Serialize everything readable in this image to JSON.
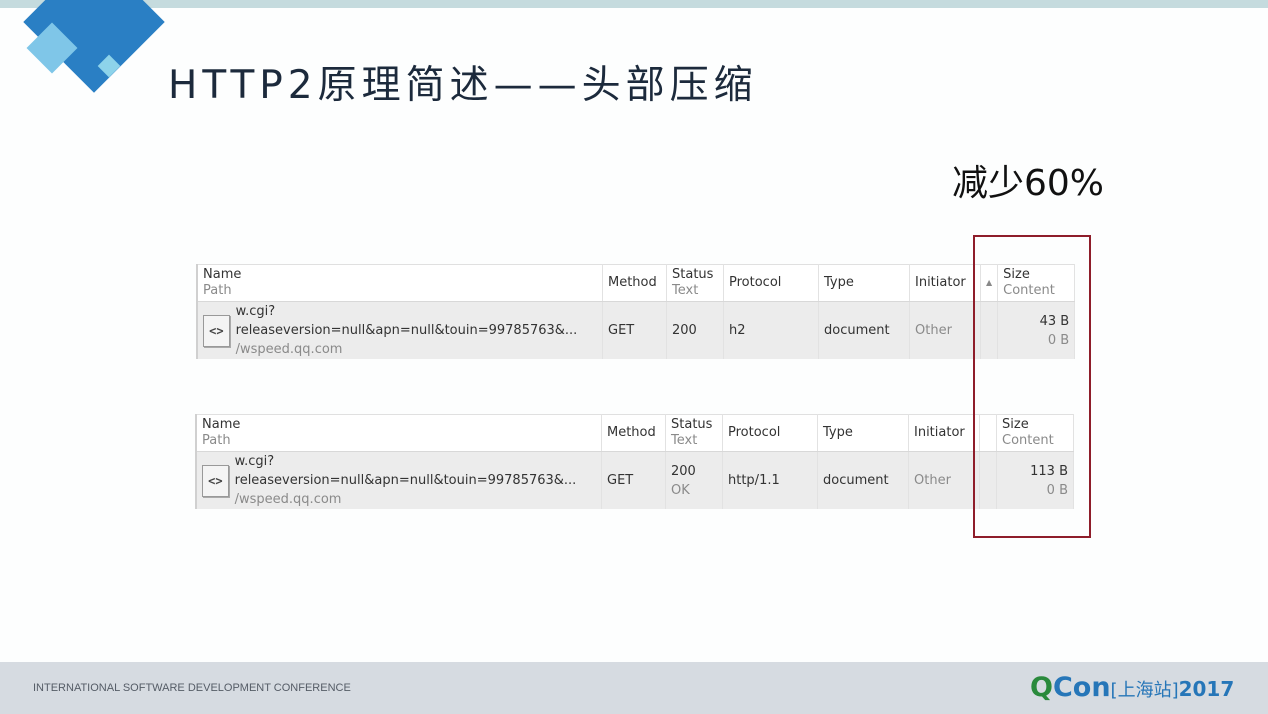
{
  "slide": {
    "title": "HTTP2原理简述——头部压缩",
    "callout": "减少60%",
    "highlight_color": "#8e1d2a",
    "accent_color": "#2a7fc4"
  },
  "columns": {
    "name": "Name",
    "path": "Path",
    "method": "Method",
    "status": "Status",
    "status_text": "Text",
    "protocol": "Protocol",
    "type": "Type",
    "initiator": "Initiator",
    "sort_indicator": "▲",
    "size": "Size",
    "content": "Content"
  },
  "tables": [
    {
      "row": {
        "icon": "<>",
        "name": "w.cgi?releaseversion=null&apn=null&touin=99785763&...",
        "path": "/wspeed.qq.com",
        "method": "GET",
        "status": "200",
        "status_text": "",
        "protocol": "h2",
        "type": "document",
        "initiator": "Other",
        "size": "43 B",
        "content": "0 B"
      }
    },
    {
      "row": {
        "icon": "<>",
        "name": "w.cgi?releaseversion=null&apn=null&touin=99785763&...",
        "path": "/wspeed.qq.com",
        "method": "GET",
        "status": "200",
        "status_text": "OK",
        "protocol": "http/1.1",
        "type": "document",
        "initiator": "Other",
        "size": "113 B",
        "content": "0 B"
      }
    }
  ],
  "footer": {
    "conference": "INTERNATIONAL SOFTWARE DEVELOPMENT CONFERENCE",
    "brand_q": "Q",
    "brand_con": "Con",
    "brand_city": "[上海站]",
    "brand_year": "2017"
  }
}
